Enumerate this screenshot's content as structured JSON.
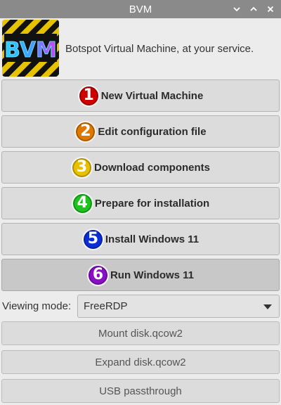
{
  "window": {
    "title": "BVM",
    "controls": [
      "minimize-icon",
      "maximize-icon",
      "close-icon"
    ]
  },
  "header": {
    "logo_text": "BVM",
    "tagline": "Botspot Virtual Machine, at your service."
  },
  "steps": [
    {
      "number": "1",
      "label": "New Virtual Machine",
      "color": "#d10000"
    },
    {
      "number": "2",
      "label": "Edit configuration file",
      "color": "#e07800"
    },
    {
      "number": "3",
      "label": "Download components",
      "color": "#e8c000"
    },
    {
      "number": "4",
      "label": "Prepare for installation",
      "color": "#1fc21f"
    },
    {
      "number": "5",
      "label": "Install Windows 11",
      "color": "#0a2fd6"
    },
    {
      "number": "6",
      "label": "Run Windows 11",
      "color": "#8a10c8"
    }
  ],
  "viewing": {
    "label": "Viewing mode:",
    "selected": "FreeRDP"
  },
  "extra_buttons": [
    {
      "label": "Mount disk.qcow2"
    },
    {
      "label": "Expand disk.qcow2"
    },
    {
      "label": "USB passthrough"
    }
  ]
}
